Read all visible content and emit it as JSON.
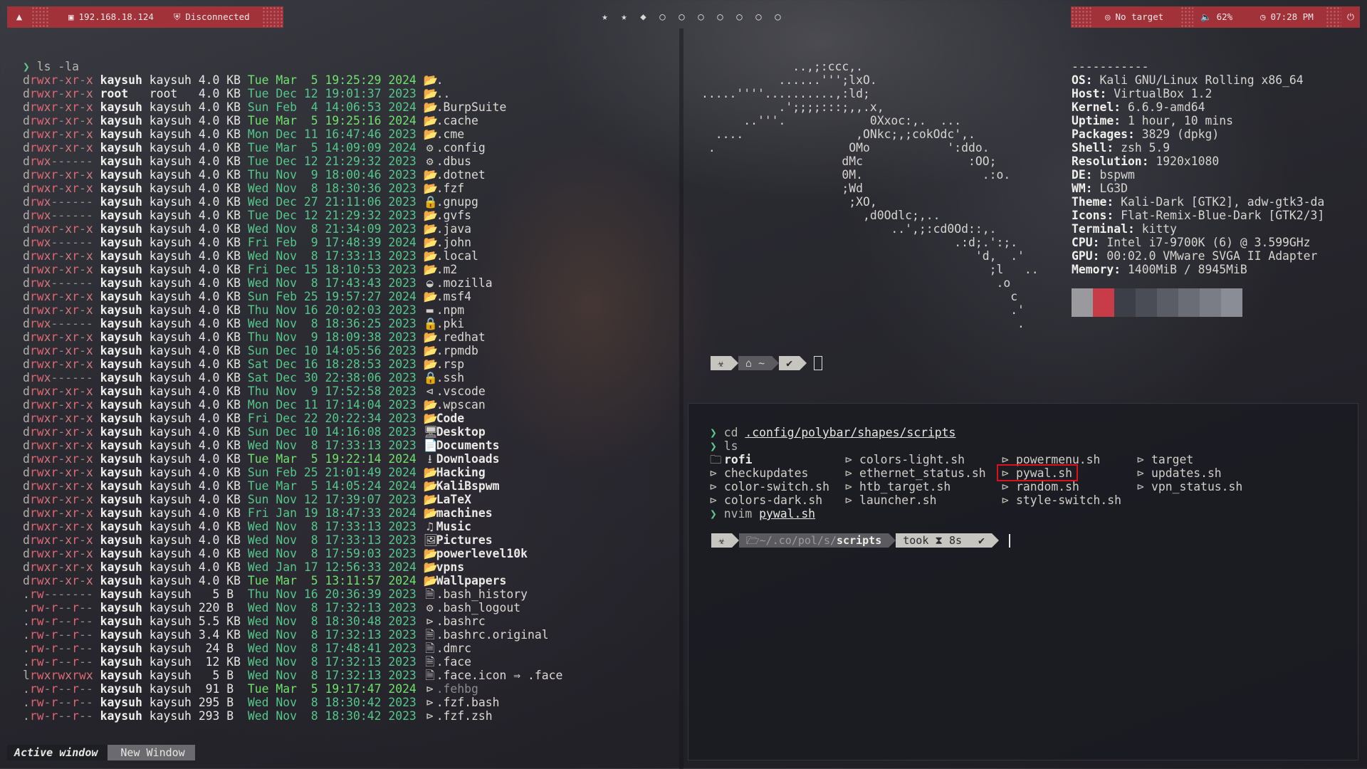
{
  "bar": {
    "logo_icon": "kali-dragon-icon",
    "ip": "192.168.18.124",
    "vpn_status": "Disconnected",
    "workspaces": [
      "★",
      "★",
      "◆",
      "○",
      "○",
      "○",
      "○",
      "○",
      "○",
      "○"
    ],
    "target": "No target",
    "volume": "62%",
    "time": "07:28 PM",
    "power_icon": "power-icon",
    "accent": "#a2323a"
  },
  "left_terminal": {
    "prompt": "❯",
    "command": "ls -la",
    "rows": [
      {
        "perm": "drwxr-xr-x",
        "user": "kaysuh",
        "group": "kaysuh",
        "size": "4.0 KB",
        "day": "Tue",
        "mon": "Mar",
        "dd": " 5",
        "time": "19:25:29",
        "year": "2024",
        "icon": "📂",
        "name": ".",
        "recent": true
      },
      {
        "perm": "drwxr-xr-x",
        "user": "root",
        "group": "root  ",
        "size": "4.0 KB",
        "day": "Tue",
        "mon": "Dec",
        "dd": "12",
        "time": "19:01:37",
        "year": "2023",
        "icon": "📂",
        "name": ".."
      },
      {
        "perm": "drwxr-xr-x",
        "user": "kaysuh",
        "group": "kaysuh",
        "size": "4.0 KB",
        "day": "Sun",
        "mon": "Feb",
        "dd": " 4",
        "time": "14:06:53",
        "year": "2024",
        "icon": "📂",
        "name": ".BurpSuite"
      },
      {
        "perm": "drwxr-xr-x",
        "user": "kaysuh",
        "group": "kaysuh",
        "size": "4.0 KB",
        "day": "Tue",
        "mon": "Mar",
        "dd": " 5",
        "time": "19:25:16",
        "year": "2024",
        "icon": "📂",
        "name": ".cache",
        "recent": true
      },
      {
        "perm": "drwxr-xr-x",
        "user": "kaysuh",
        "group": "kaysuh",
        "size": "4.0 KB",
        "day": "Mon",
        "mon": "Dec",
        "dd": "11",
        "time": "16:47:46",
        "year": "2023",
        "icon": "📂",
        "name": ".cme"
      },
      {
        "perm": "drwxr-xr-x",
        "user": "kaysuh",
        "group": "kaysuh",
        "size": "4.0 KB",
        "day": "Tue",
        "mon": "Mar",
        "dd": " 5",
        "time": "14:09:09",
        "year": "2024",
        "icon": "⚙",
        "name": ".config"
      },
      {
        "perm": "drwx------",
        "user": "kaysuh",
        "group": "kaysuh",
        "size": "4.0 KB",
        "day": "Tue",
        "mon": "Dec",
        "dd": "12",
        "time": "21:29:32",
        "year": "2023",
        "icon": "⚙",
        "name": ".dbus"
      },
      {
        "perm": "drwxr-xr-x",
        "user": "kaysuh",
        "group": "kaysuh",
        "size": "4.0 KB",
        "day": "Thu",
        "mon": "Nov",
        "dd": " 9",
        "time": "18:00:46",
        "year": "2023",
        "icon": "📂",
        "name": ".dotnet"
      },
      {
        "perm": "drwxr-xr-x",
        "user": "kaysuh",
        "group": "kaysuh",
        "size": "4.0 KB",
        "day": "Wed",
        "mon": "Nov",
        "dd": " 8",
        "time": "18:30:36",
        "year": "2023",
        "icon": "📂",
        "name": ".fzf"
      },
      {
        "perm": "drwx------",
        "user": "kaysuh",
        "group": "kaysuh",
        "size": "4.0 KB",
        "day": "Wed",
        "mon": "Dec",
        "dd": "27",
        "time": "21:11:06",
        "year": "2023",
        "icon": "🔒",
        "name": ".gnupg"
      },
      {
        "perm": "drwx------",
        "user": "kaysuh",
        "group": "kaysuh",
        "size": "4.0 KB",
        "day": "Tue",
        "mon": "Dec",
        "dd": "12",
        "time": "21:29:32",
        "year": "2023",
        "icon": "📂",
        "name": ".gvfs"
      },
      {
        "perm": "drwxr-xr-x",
        "user": "kaysuh",
        "group": "kaysuh",
        "size": "4.0 KB",
        "day": "Wed",
        "mon": "Nov",
        "dd": " 8",
        "time": "21:34:09",
        "year": "2023",
        "icon": "📂",
        "name": ".java"
      },
      {
        "perm": "drwx------",
        "user": "kaysuh",
        "group": "kaysuh",
        "size": "4.0 KB",
        "day": "Fri",
        "mon": "Feb",
        "dd": " 9",
        "time": "17:48:39",
        "year": "2024",
        "icon": "📂",
        "name": ".john"
      },
      {
        "perm": "drwxr-xr-x",
        "user": "kaysuh",
        "group": "kaysuh",
        "size": "4.0 KB",
        "day": "Wed",
        "mon": "Nov",
        "dd": " 8",
        "time": "17:33:13",
        "year": "2023",
        "icon": "📂",
        "name": ".local"
      },
      {
        "perm": "drwxr-xr-x",
        "user": "kaysuh",
        "group": "kaysuh",
        "size": "4.0 KB",
        "day": "Fri",
        "mon": "Dec",
        "dd": "15",
        "time": "18:10:53",
        "year": "2023",
        "icon": "📂",
        "name": ".m2"
      },
      {
        "perm": "drwx------",
        "user": "kaysuh",
        "group": "kaysuh",
        "size": "4.0 KB",
        "day": "Wed",
        "mon": "Nov",
        "dd": " 8",
        "time": "17:43:43",
        "year": "2023",
        "icon": "◒",
        "name": ".mozilla"
      },
      {
        "perm": "drwxr-xr-x",
        "user": "kaysuh",
        "group": "kaysuh",
        "size": "4.0 KB",
        "day": "Sun",
        "mon": "Feb",
        "dd": "25",
        "time": "19:57:27",
        "year": "2024",
        "icon": "📂",
        "name": ".msf4"
      },
      {
        "perm": "drwxr-xr-x",
        "user": "kaysuh",
        "group": "kaysuh",
        "size": "4.0 KB",
        "day": "Thu",
        "mon": "Nov",
        "dd": "16",
        "time": "20:02:03",
        "year": "2023",
        "icon": "▬",
        "name": ".npm"
      },
      {
        "perm": "drwx------",
        "user": "kaysuh",
        "group": "kaysuh",
        "size": "4.0 KB",
        "day": "Wed",
        "mon": "Nov",
        "dd": " 8",
        "time": "18:36:25",
        "year": "2023",
        "icon": "🔒",
        "name": ".pki"
      },
      {
        "perm": "drwxr-xr-x",
        "user": "kaysuh",
        "group": "kaysuh",
        "size": "4.0 KB",
        "day": "Thu",
        "mon": "Nov",
        "dd": " 9",
        "time": "18:09:38",
        "year": "2023",
        "icon": "📂",
        "name": ".redhat"
      },
      {
        "perm": "drwxr-xr-x",
        "user": "kaysuh",
        "group": "kaysuh",
        "size": "4.0 KB",
        "day": "Sun",
        "mon": "Dec",
        "dd": "10",
        "time": "14:05:56",
        "year": "2023",
        "icon": "📂",
        "name": ".rpmdb"
      },
      {
        "perm": "drwxr-xr-x",
        "user": "kaysuh",
        "group": "kaysuh",
        "size": "4.0 KB",
        "day": "Sat",
        "mon": "Dec",
        "dd": "16",
        "time": "18:28:53",
        "year": "2023",
        "icon": "📂",
        "name": ".rsp"
      },
      {
        "perm": "drwx------",
        "user": "kaysuh",
        "group": "kaysuh",
        "size": "4.0 KB",
        "day": "Sat",
        "mon": "Dec",
        "dd": "30",
        "time": "22:38:06",
        "year": "2023",
        "icon": "🔒",
        "name": ".ssh"
      },
      {
        "perm": "drwxr-xr-x",
        "user": "kaysuh",
        "group": "kaysuh",
        "size": "4.0 KB",
        "day": "Thu",
        "mon": "Nov",
        "dd": " 9",
        "time": "17:52:58",
        "year": "2023",
        "icon": "⊲",
        "name": ".vscode"
      },
      {
        "perm": "drwxr-xr-x",
        "user": "kaysuh",
        "group": "kaysuh",
        "size": "4.0 KB",
        "day": "Mon",
        "mon": "Dec",
        "dd": "11",
        "time": "17:14:04",
        "year": "2023",
        "icon": "📂",
        "name": ".wpscan"
      },
      {
        "perm": "drwxr-xr-x",
        "user": "kaysuh",
        "group": "kaysuh",
        "size": "4.0 KB",
        "day": "Fri",
        "mon": "Dec",
        "dd": "22",
        "time": "20:22:34",
        "year": "2023",
        "icon": "📂",
        "name": "Code",
        "bold": true
      },
      {
        "perm": "drwxr-xr-x",
        "user": "kaysuh",
        "group": "kaysuh",
        "size": "4.0 KB",
        "day": "Sun",
        "mon": "Dec",
        "dd": "10",
        "time": "14:16:08",
        "year": "2023",
        "icon": "🖥",
        "name": "Desktop",
        "bold": true
      },
      {
        "perm": "drwxr-xr-x",
        "user": "kaysuh",
        "group": "kaysuh",
        "size": "4.0 KB",
        "day": "Wed",
        "mon": "Nov",
        "dd": " 8",
        "time": "17:33:13",
        "year": "2023",
        "icon": "📄",
        "name": "Documents",
        "bold": true
      },
      {
        "perm": "drwxr-xr-x",
        "user": "kaysuh",
        "group": "kaysuh",
        "size": "4.0 KB",
        "day": "Tue",
        "mon": "Mar",
        "dd": " 5",
        "time": "19:22:14",
        "year": "2024",
        "icon": "⭳",
        "name": "Downloads",
        "bold": true,
        "recent": true
      },
      {
        "perm": "drwxr-xr-x",
        "user": "kaysuh",
        "group": "kaysuh",
        "size": "4.0 KB",
        "day": "Sun",
        "mon": "Feb",
        "dd": "25",
        "time": "21:01:49",
        "year": "2024",
        "icon": "📂",
        "name": "Hacking",
        "bold": true
      },
      {
        "perm": "drwxr-xr-x",
        "user": "kaysuh",
        "group": "kaysuh",
        "size": "4.0 KB",
        "day": "Tue",
        "mon": "Mar",
        "dd": " 5",
        "time": "14:05:24",
        "year": "2024",
        "icon": "📂",
        "name": "KaliBspwm",
        "bold": true
      },
      {
        "perm": "drwxr-xr-x",
        "user": "kaysuh",
        "group": "kaysuh",
        "size": "4.0 KB",
        "day": "Sun",
        "mon": "Nov",
        "dd": "12",
        "time": "17:39:07",
        "year": "2023",
        "icon": "📂",
        "name": "LaTeX",
        "bold": true
      },
      {
        "perm": "drwxr-xr-x",
        "user": "kaysuh",
        "group": "kaysuh",
        "size": "4.0 KB",
        "day": "Fri",
        "mon": "Jan",
        "dd": "19",
        "time": "18:47:33",
        "year": "2024",
        "icon": "📂",
        "name": "machines",
        "bold": true
      },
      {
        "perm": "drwxr-xr-x",
        "user": "kaysuh",
        "group": "kaysuh",
        "size": "4.0 KB",
        "day": "Wed",
        "mon": "Nov",
        "dd": " 8",
        "time": "17:33:13",
        "year": "2023",
        "icon": "♫",
        "name": "Music",
        "bold": true
      },
      {
        "perm": "drwxr-xr-x",
        "user": "kaysuh",
        "group": "kaysuh",
        "size": "4.0 KB",
        "day": "Wed",
        "mon": "Nov",
        "dd": " 8",
        "time": "17:33:13",
        "year": "2023",
        "icon": "🖼",
        "name": "Pictures",
        "bold": true
      },
      {
        "perm": "drwxr-xr-x",
        "user": "kaysuh",
        "group": "kaysuh",
        "size": "4.0 KB",
        "day": "Wed",
        "mon": "Nov",
        "dd": " 8",
        "time": "17:59:03",
        "year": "2023",
        "icon": "📂",
        "name": "powerlevel10k",
        "bold": true
      },
      {
        "perm": "drwxr-xr-x",
        "user": "kaysuh",
        "group": "kaysuh",
        "size": "4.0 KB",
        "day": "Wed",
        "mon": "Jan",
        "dd": "17",
        "time": "12:56:33",
        "year": "2024",
        "icon": "📂",
        "name": "vpns",
        "bold": true
      },
      {
        "perm": "drwxr-xr-x",
        "user": "kaysuh",
        "group": "kaysuh",
        "size": "4.0 KB",
        "day": "Tue",
        "mon": "Mar",
        "dd": " 5",
        "time": "13:11:57",
        "year": "2024",
        "icon": "📂",
        "name": "Wallpapers",
        "bold": true,
        "recent": true
      },
      {
        "perm": ".rw-------",
        "user": "kaysuh",
        "group": "kaysuh",
        "size": "  5 B ",
        "day": "Thu",
        "mon": "Nov",
        "dd": "16",
        "time": "20:36:39",
        "year": "2023",
        "icon": "🗎",
        "name": ".bash_history"
      },
      {
        "perm": ".rw-r--r--",
        "user": "kaysuh",
        "group": "kaysuh",
        "size": "220 B ",
        "day": "Wed",
        "mon": "Nov",
        "dd": " 8",
        "time": "17:32:13",
        "year": "2023",
        "icon": "⚙",
        "name": ".bash_logout"
      },
      {
        "perm": ".rw-r--r--",
        "user": "kaysuh",
        "group": "kaysuh",
        "size": "5.5 KB",
        "day": "Wed",
        "mon": "Nov",
        "dd": " 8",
        "time": "18:30:48",
        "year": "2023",
        "icon": "⊳",
        "name": ".bashrc"
      },
      {
        "perm": ".rw-r--r--",
        "user": "kaysuh",
        "group": "kaysuh",
        "size": "3.4 KB",
        "day": "Wed",
        "mon": "Nov",
        "dd": " 8",
        "time": "17:32:13",
        "year": "2023",
        "icon": "🗎",
        "name": ".bashrc.original"
      },
      {
        "perm": ".rw-r--r--",
        "user": "kaysuh",
        "group": "kaysuh",
        "size": " 24 B ",
        "day": "Wed",
        "mon": "Nov",
        "dd": " 8",
        "time": "17:48:41",
        "year": "2023",
        "icon": "🗎",
        "name": ".dmrc"
      },
      {
        "perm": ".rw-r--r--",
        "user": "kaysuh",
        "group": "kaysuh",
        "size": " 12 KB",
        "day": "Wed",
        "mon": "Nov",
        "dd": " 8",
        "time": "17:32:13",
        "year": "2023",
        "icon": "🗎",
        "name": ".face"
      },
      {
        "perm": "lrwxrwxrwx",
        "user": "kaysuh",
        "group": "kaysuh",
        "size": "  5 B ",
        "day": "Wed",
        "mon": "Nov",
        "dd": " 8",
        "time": "17:32:13",
        "year": "2023",
        "icon": "🗎",
        "name": ".face.icon ⇒ .face"
      },
      {
        "perm": ".rw-r--r--",
        "user": "kaysuh",
        "group": "kaysuh",
        "size": " 91 B ",
        "day": "Tue",
        "mon": "Mar",
        "dd": " 5",
        "time": "19:17:47",
        "year": "2024",
        "icon": "⊳",
        "name": ".fehbg",
        "recent": true,
        "dim": true
      },
      {
        "perm": ".rw-r--r--",
        "user": "kaysuh",
        "group": "kaysuh",
        "size": "295 B ",
        "day": "Wed",
        "mon": "Nov",
        "dd": " 8",
        "time": "18:30:42",
        "year": "2023",
        "icon": "⊳",
        "name": ".fzf.bash"
      },
      {
        "perm": ".rw-r--r--",
        "user": "kaysuh",
        "group": "kaysuh",
        "size": "293 B ",
        "day": "Wed",
        "mon": "Nov",
        "dd": " 8",
        "time": "18:30:42",
        "year": "2023",
        "icon": "⊳",
        "name": ".fzf.zsh"
      }
    ]
  },
  "neofetch": {
    "ascii": [
      "             ..,;:ccc,.",
      "           ......''';lxO.",
      ".....''''..........,:ld;",
      "           .';;;;:::;,,.x,",
      "      ..'''.            0Xxoc:,.  ...",
      "  ....                ,ONkc;,;cokOdc',.",
      " .                   OMo           ':ddo.",
      "                    dMc               :OO;",
      "                    0M.                 .:o.",
      "                    ;Wd",
      "                     ;XO,",
      "                       ,d0Odlc;,..",
      "                           ..',;:cd0Od::,.",
      "                                    .:d;.':;.",
      "                                       'd,  .'",
      "                                         ;l   ..",
      "                                          .o",
      "                                            c",
      "                                            .'",
      "                                             ."
    ],
    "separator": "-----------",
    "info": [
      {
        "k": "OS",
        "v": "Kali GNU/Linux Rolling x86_64"
      },
      {
        "k": "Host",
        "v": "VirtualBox 1.2"
      },
      {
        "k": "Kernel",
        "v": "6.6.9-amd64"
      },
      {
        "k": "Uptime",
        "v": "1 hour, 10 mins"
      },
      {
        "k": "Packages",
        "v": "3829 (dpkg)"
      },
      {
        "k": "Shell",
        "v": "zsh 5.9"
      },
      {
        "k": "Resolution",
        "v": "1920x1080"
      },
      {
        "k": "DE",
        "v": "bspwm"
      },
      {
        "k": "WM",
        "v": "LG3D"
      },
      {
        "k": "Theme",
        "v": "Kali-Dark [GTK2], adw-gtk3-da"
      },
      {
        "k": "Icons",
        "v": "Flat-Remix-Blue-Dark [GTK2/3]"
      },
      {
        "k": "Terminal",
        "v": "kitty"
      },
      {
        "k": "CPU",
        "v": "Intel i7-9700K (6) @ 3.599GHz"
      },
      {
        "k": "GPU",
        "v": "00:02.0 VMware SVGA II Adapter"
      },
      {
        "k": "Memory",
        "v": "1400MiB / 8945MiB"
      }
    ],
    "palette": [
      "#9a9a9e",
      "#c83c48",
      "#3c3e48",
      "#4a4c56",
      "#5a5c66",
      "#6a6c76",
      "#7a7c86",
      "#8a8c96"
    ],
    "prompt": {
      "icon": "kali-dragon-icon",
      "dir_icon": "home-icon",
      "dir": "~",
      "check": "✔"
    }
  },
  "right_terminal": {
    "cmd1_prompt": "❯",
    "cmd1": "cd",
    "cmd1_arg": ".config/polybar/shapes/scripts",
    "cmd2": "ls",
    "ls_items": [
      {
        "name": "rofi",
        "dir": true
      },
      {
        "name": "checkupdates"
      },
      {
        "name": "color-switch.sh"
      },
      {
        "name": "colors-dark.sh"
      },
      {
        "name": "colors-light.sh"
      },
      {
        "name": "ethernet_status.sh"
      },
      {
        "name": "htb_target.sh"
      },
      {
        "name": "launcher.sh"
      },
      {
        "name": "powermenu.sh"
      },
      {
        "name": "pywal.sh",
        "highlight": true
      },
      {
        "name": "random.sh"
      },
      {
        "name": "style-switch.sh"
      },
      {
        "name": "target"
      },
      {
        "name": "updates.sh"
      },
      {
        "name": "vpn_status.sh"
      }
    ],
    "cmd3": "nvim",
    "cmd3_arg": "pywal.sh",
    "prompt": {
      "path_dim": "~/.co/pol/s/",
      "path_bold": "scripts",
      "took": "took",
      "hourglass": "⧗",
      "duration": "8s",
      "check": "✔"
    }
  },
  "bottom_bar": {
    "active": "Active window",
    "new": "New Window"
  }
}
